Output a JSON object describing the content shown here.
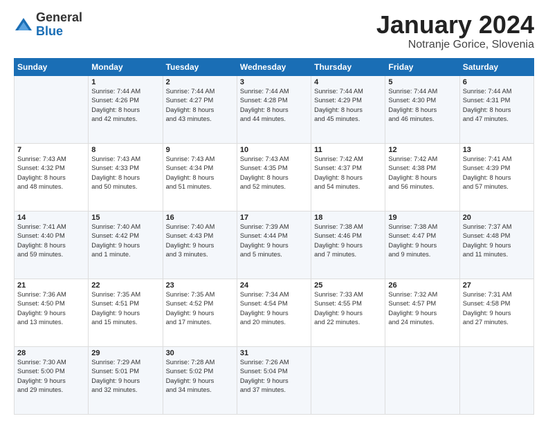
{
  "logo": {
    "general": "General",
    "blue": "Blue"
  },
  "header": {
    "month": "January 2024",
    "location": "Notranje Gorice, Slovenia"
  },
  "weekdays": [
    "Sunday",
    "Monday",
    "Tuesday",
    "Wednesday",
    "Thursday",
    "Friday",
    "Saturday"
  ],
  "weeks": [
    [
      {
        "day": "",
        "info": ""
      },
      {
        "day": "1",
        "info": "Sunrise: 7:44 AM\nSunset: 4:26 PM\nDaylight: 8 hours\nand 42 minutes."
      },
      {
        "day": "2",
        "info": "Sunrise: 7:44 AM\nSunset: 4:27 PM\nDaylight: 8 hours\nand 43 minutes."
      },
      {
        "day": "3",
        "info": "Sunrise: 7:44 AM\nSunset: 4:28 PM\nDaylight: 8 hours\nand 44 minutes."
      },
      {
        "day": "4",
        "info": "Sunrise: 7:44 AM\nSunset: 4:29 PM\nDaylight: 8 hours\nand 45 minutes."
      },
      {
        "day": "5",
        "info": "Sunrise: 7:44 AM\nSunset: 4:30 PM\nDaylight: 8 hours\nand 46 minutes."
      },
      {
        "day": "6",
        "info": "Sunrise: 7:44 AM\nSunset: 4:31 PM\nDaylight: 8 hours\nand 47 minutes."
      }
    ],
    [
      {
        "day": "7",
        "info": "Sunrise: 7:43 AM\nSunset: 4:32 PM\nDaylight: 8 hours\nand 48 minutes."
      },
      {
        "day": "8",
        "info": "Sunrise: 7:43 AM\nSunset: 4:33 PM\nDaylight: 8 hours\nand 50 minutes."
      },
      {
        "day": "9",
        "info": "Sunrise: 7:43 AM\nSunset: 4:34 PM\nDaylight: 8 hours\nand 51 minutes."
      },
      {
        "day": "10",
        "info": "Sunrise: 7:43 AM\nSunset: 4:35 PM\nDaylight: 8 hours\nand 52 minutes."
      },
      {
        "day": "11",
        "info": "Sunrise: 7:42 AM\nSunset: 4:37 PM\nDaylight: 8 hours\nand 54 minutes."
      },
      {
        "day": "12",
        "info": "Sunrise: 7:42 AM\nSunset: 4:38 PM\nDaylight: 8 hours\nand 56 minutes."
      },
      {
        "day": "13",
        "info": "Sunrise: 7:41 AM\nSunset: 4:39 PM\nDaylight: 8 hours\nand 57 minutes."
      }
    ],
    [
      {
        "day": "14",
        "info": "Sunrise: 7:41 AM\nSunset: 4:40 PM\nDaylight: 8 hours\nand 59 minutes."
      },
      {
        "day": "15",
        "info": "Sunrise: 7:40 AM\nSunset: 4:42 PM\nDaylight: 9 hours\nand 1 minute."
      },
      {
        "day": "16",
        "info": "Sunrise: 7:40 AM\nSunset: 4:43 PM\nDaylight: 9 hours\nand 3 minutes."
      },
      {
        "day": "17",
        "info": "Sunrise: 7:39 AM\nSunset: 4:44 PM\nDaylight: 9 hours\nand 5 minutes."
      },
      {
        "day": "18",
        "info": "Sunrise: 7:38 AM\nSunset: 4:46 PM\nDaylight: 9 hours\nand 7 minutes."
      },
      {
        "day": "19",
        "info": "Sunrise: 7:38 AM\nSunset: 4:47 PM\nDaylight: 9 hours\nand 9 minutes."
      },
      {
        "day": "20",
        "info": "Sunrise: 7:37 AM\nSunset: 4:48 PM\nDaylight: 9 hours\nand 11 minutes."
      }
    ],
    [
      {
        "day": "21",
        "info": "Sunrise: 7:36 AM\nSunset: 4:50 PM\nDaylight: 9 hours\nand 13 minutes."
      },
      {
        "day": "22",
        "info": "Sunrise: 7:35 AM\nSunset: 4:51 PM\nDaylight: 9 hours\nand 15 minutes."
      },
      {
        "day": "23",
        "info": "Sunrise: 7:35 AM\nSunset: 4:52 PM\nDaylight: 9 hours\nand 17 minutes."
      },
      {
        "day": "24",
        "info": "Sunrise: 7:34 AM\nSunset: 4:54 PM\nDaylight: 9 hours\nand 20 minutes."
      },
      {
        "day": "25",
        "info": "Sunrise: 7:33 AM\nSunset: 4:55 PM\nDaylight: 9 hours\nand 22 minutes."
      },
      {
        "day": "26",
        "info": "Sunrise: 7:32 AM\nSunset: 4:57 PM\nDaylight: 9 hours\nand 24 minutes."
      },
      {
        "day": "27",
        "info": "Sunrise: 7:31 AM\nSunset: 4:58 PM\nDaylight: 9 hours\nand 27 minutes."
      }
    ],
    [
      {
        "day": "28",
        "info": "Sunrise: 7:30 AM\nSunset: 5:00 PM\nDaylight: 9 hours\nand 29 minutes."
      },
      {
        "day": "29",
        "info": "Sunrise: 7:29 AM\nSunset: 5:01 PM\nDaylight: 9 hours\nand 32 minutes."
      },
      {
        "day": "30",
        "info": "Sunrise: 7:28 AM\nSunset: 5:02 PM\nDaylight: 9 hours\nand 34 minutes."
      },
      {
        "day": "31",
        "info": "Sunrise: 7:26 AM\nSunset: 5:04 PM\nDaylight: 9 hours\nand 37 minutes."
      },
      {
        "day": "",
        "info": ""
      },
      {
        "day": "",
        "info": ""
      },
      {
        "day": "",
        "info": ""
      }
    ]
  ]
}
